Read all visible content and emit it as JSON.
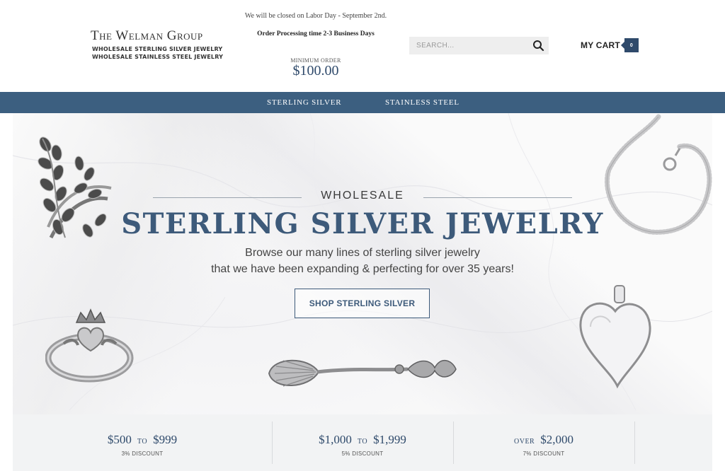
{
  "header": {
    "logo": {
      "title": "The Welman Group",
      "line1": "WHOLESALE STERLING SILVER JEWELRY",
      "line2": "WHOLESALE STAINLESS STEEL JEWELRY"
    },
    "notice": "We will be closed on Labor Day - September 2nd.",
    "processing": "Order Processing time 2-3 Business Days",
    "minimum_label": "MINIMUM ORDER",
    "minimum_value": "$100.00",
    "search": {
      "placeholder": "SEARCH..."
    },
    "cart": {
      "label": "MY CART",
      "count": "0"
    }
  },
  "nav": {
    "items": [
      {
        "label": "STERLING SILVER"
      },
      {
        "label": "STAINLESS STEEL"
      }
    ]
  },
  "hero": {
    "eyebrow": "WHOLESALE",
    "title": "STERLING SILVER JEWELRY",
    "line1": "Browse our many lines of sterling silver jewelry",
    "line2": "that we have been expanding & perfecting for over 35 years!",
    "cta": "SHOP STERLING SILVER"
  },
  "discounts": [
    {
      "from": "$500",
      "word": "TO",
      "to": "$999",
      "note": "3% DISCOUNT"
    },
    {
      "from": "$1,000",
      "word": "TO",
      "to": "$1,999",
      "note": "5% DISCOUNT"
    },
    {
      "word": "OVER",
      "to": "$2,000",
      "note": "7% DISCOUNT"
    }
  ],
  "colors": {
    "brand_navy": "#3c5f80",
    "title_blue": "#3d5a7a",
    "price_blue": "#2f4a6b"
  },
  "icons": {
    "search": "magnifier-icon",
    "ring_leaf": "leaf-ring-image",
    "bracelet": "bead-chain-bracelet-image",
    "claddagh": "claddagh-ring-image",
    "spoon": "shell-spoon-image",
    "locket": "heart-locket-image"
  }
}
